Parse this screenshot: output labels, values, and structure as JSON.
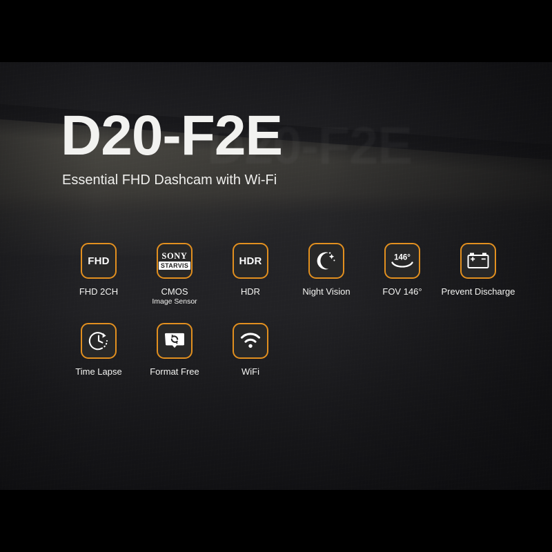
{
  "hero": {
    "title": "D20-F2E",
    "subtitle": "Essential FHD Dashcam with Wi-Fi",
    "watermark": "D20-F2E"
  },
  "colors": {
    "accent_orange": "#e3901f",
    "tile_fill": "#282828",
    "text_white": "#f4f4f2",
    "letterbox": "#000000",
    "backdrop_dark": "#232326"
  },
  "features": {
    "rows": [
      [
        {
          "icon": "fhd-badge-icon",
          "tile_text": "FHD",
          "caption": "FHD 2CH",
          "caption_sub": ""
        },
        {
          "icon": "sony-starvis-logo-icon",
          "tile_text": "",
          "logo_primary": "SONY",
          "logo_secondary": "STARVIS",
          "caption": "CMOS",
          "caption_sub": "Image Sensor"
        },
        {
          "icon": "hdr-badge-icon",
          "tile_text": "HDR",
          "caption": "HDR",
          "caption_sub": ""
        },
        {
          "icon": "moon-star-icon",
          "tile_text": "",
          "caption": "Night Vision",
          "caption_sub": ""
        },
        {
          "icon": "fov-arc-icon",
          "tile_text": "146°",
          "caption": "FOV 146°",
          "caption_sub": ""
        },
        {
          "icon": "car-battery-icon",
          "tile_text": "",
          "caption": "Prevent Discharge",
          "caption_sub": ""
        }
      ],
      [
        {
          "icon": "clock-timelapse-icon",
          "tile_text": "",
          "caption": "Time Lapse",
          "caption_sub": ""
        },
        {
          "icon": "sdcard-refresh-icon",
          "tile_text": "",
          "caption": "Format Free",
          "caption_sub": ""
        },
        {
          "icon": "wifi-signal-icon",
          "tile_text": "",
          "caption": "WiFi",
          "caption_sub": ""
        }
      ]
    ]
  }
}
